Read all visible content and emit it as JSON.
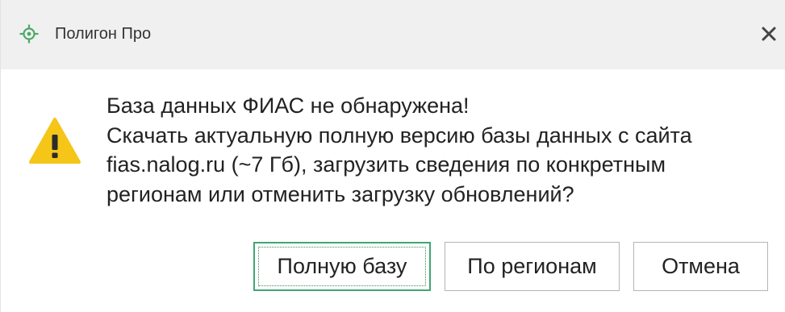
{
  "window": {
    "title": "Полигон Про",
    "app_icon": "polygon-target-icon",
    "close_icon": "close-icon"
  },
  "dialog": {
    "icon": "warning-icon",
    "message_lines": [
      "База данных ФИАС не обнаружена!",
      "Скачать актуальную полную версию базы данных с сайта",
      "fias.nalog.ru (~7 Гб), загрузить сведения по конкретным",
      "регионам или отменить загрузку обновлений?"
    ]
  },
  "buttons": {
    "full_db": "Полную базу",
    "by_regions": "По регионам",
    "cancel": "Отмена"
  },
  "colors": {
    "accent": "#3fa672",
    "warning": "#f5c518",
    "titlebar": "#f0f0f0"
  }
}
